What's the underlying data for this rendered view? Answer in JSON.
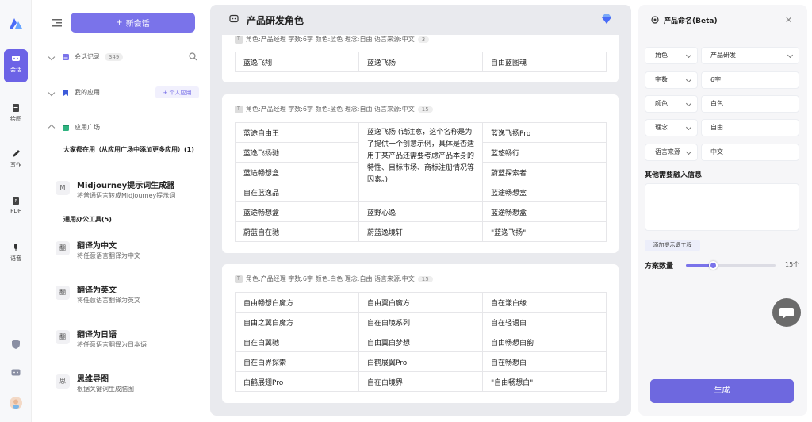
{
  "rail": {
    "items": [
      {
        "label": "会话",
        "icon": "chat-icon",
        "active": true
      },
      {
        "label": "绘图",
        "icon": "draw-icon"
      },
      {
        "label": "写作",
        "icon": "pen-icon"
      },
      {
        "label": "PDF",
        "icon": "pdf-icon"
      },
      {
        "label": "语音",
        "icon": "mic-icon"
      }
    ]
  },
  "sidebar": {
    "new_chat_label": "新会话",
    "sections": {
      "history": {
        "label": "会话记录",
        "count": "349"
      },
      "my_apps": {
        "label": "我的应用",
        "add_label": "+ 个人应用"
      },
      "app_store": {
        "label": "应用广场"
      }
    },
    "group1_title": "大家都在用（从应用广场中添加更多应用）(1)",
    "group2_title": "通用办公工具(5)",
    "apps": [
      {
        "avatar": "M",
        "name": "Midjourney提示词生成器",
        "desc": "将普通语言转成Midjourney提示词"
      },
      {
        "avatar": "翻",
        "name": "翻译为中文",
        "desc": "将任意语言翻译为中文"
      },
      {
        "avatar": "翻",
        "name": "翻译为英文",
        "desc": "将任意语言翻译为英文"
      },
      {
        "avatar": "翻",
        "name": "翻译为日语",
        "desc": "将任意语言翻译为日本语"
      },
      {
        "avatar": "思",
        "name": "思维导图",
        "desc": "根据关键词生成脑图"
      }
    ]
  },
  "main": {
    "title": "产品研发角色",
    "cards": [
      {
        "tag": "T",
        "meta": "角色:产品经理 字数:6字 颜色:蓝色 理念:自由 语言来源:中文",
        "count": "3",
        "rows": [
          [
            "蓝逸飞翔",
            "蓝逸飞扬",
            "自由蓝图魂"
          ]
        ]
      },
      {
        "tag": "T",
        "meta": "角色:产品经理 字数:6字 颜色:蓝色 理念:自由 语言来源:中文",
        "count": "15",
        "col1": [
          "蓝途自由王",
          "蓝逸飞扬驰",
          "蓝途畅想盒",
          "自在蓝逸品",
          "蓝途畅想盒",
          "蔚蓝自在驰"
        ],
        "col2_note": "蓝逸飞扬 (请注意，这个名称是为了提供一个创意示例，具体是否适用于某产品还需要考虑产品本身的特性、目标市场、商标注册情况等因素。)",
        "col2_rest": [
          "蓝野心逸",
          "蔚蓝逸境轩"
        ],
        "col3": [
          "蓝逸飞扬Pro",
          "蓝悠畅行",
          "蔚蓝探索者",
          "蓝途畅想盒",
          "蓝途畅想盒",
          "\"蓝逸飞扬\""
        ]
      },
      {
        "tag": "T",
        "meta": "角色:产品经理 字数:6字 颜色:白色 理念:自由 语言来源:中文",
        "count": "15",
        "rows": [
          [
            "自由畅想白魔方",
            "自由翼白魔方",
            "自在漾白缘"
          ],
          [
            "自由之翼白魔方",
            "自在白境系列",
            "自在轻语白"
          ],
          [
            "自在白翼驰",
            "自由翼白梦想",
            "自由畅想白韵"
          ],
          [
            "自在白界探索",
            "白鹤展翼Pro",
            "自在畅想白"
          ],
          [
            "白鹤展翅Pro",
            "自在白境界",
            "\"自由畅想白\""
          ]
        ]
      }
    ]
  },
  "panel": {
    "title": "产品命名(Beta)",
    "fields": [
      {
        "label": "角色",
        "value": "产品研发",
        "label_dd": true,
        "value_dd": true
      },
      {
        "label": "字数",
        "value": "6字",
        "label_dd": true,
        "value_dd": false
      },
      {
        "label": "颜色",
        "value": "白色",
        "label_dd": true,
        "value_dd": false
      },
      {
        "label": "理念",
        "value": "自由",
        "label_dd": true,
        "value_dd": false
      },
      {
        "label": "语言来源",
        "value": "中文",
        "label_dd": true,
        "value_dd": false
      }
    ],
    "extra_label": "其他需要融入信息",
    "extra_value": "",
    "add_prompt_label": "添加提示词工程",
    "count_label": "方案数量",
    "count_value": "15个",
    "count_fraction": 0.3,
    "generate_label": "生成"
  },
  "colors": {
    "accent": "#7a73ea"
  }
}
